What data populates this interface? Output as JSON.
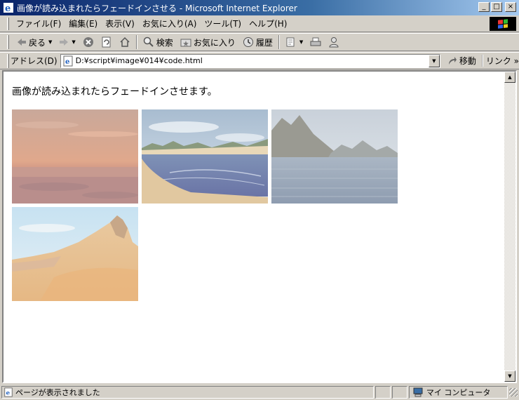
{
  "window": {
    "title": "画像が読み込まれたらフェードインさせる - Microsoft Internet Explorer",
    "minimize_label": "_",
    "maximize_label": "□",
    "close_label": "×"
  },
  "menu": {
    "items": [
      {
        "label": "ファイル(F)"
      },
      {
        "label": "編集(E)"
      },
      {
        "label": "表示(V)"
      },
      {
        "label": "お気に入り(A)"
      },
      {
        "label": "ツール(T)"
      },
      {
        "label": "ヘルプ(H)"
      }
    ]
  },
  "toolbar": {
    "back_label": "戻る",
    "search_label": "検索",
    "favorites_label": "お気に入り",
    "history_label": "履歴"
  },
  "address": {
    "label": "アドレス(D)",
    "url": "D:¥script¥image¥014¥code.html",
    "go_label": "移動",
    "links_label": "リンク »"
  },
  "page": {
    "heading": "画像が読み込まれたらフェードインさせます。",
    "images": [
      {
        "name": "sunset-plain"
      },
      {
        "name": "blue-bay-beach"
      },
      {
        "name": "mountain-lake"
      },
      {
        "name": "desert-peak"
      }
    ]
  },
  "status": {
    "text": "ページが表示されました",
    "zone": "マイ コンピュータ"
  },
  "colors": {
    "titlebar_start": "#0a246a",
    "titlebar_end": "#a6caf0",
    "chrome": "#d4d0c8"
  }
}
